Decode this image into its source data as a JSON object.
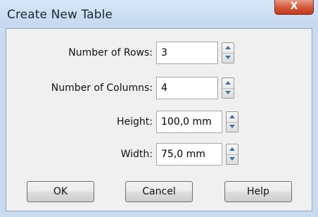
{
  "window": {
    "title": "Create New Table",
    "close_symbol": "X"
  },
  "fields": [
    {
      "label": "Number of Rows:",
      "value": "3"
    },
    {
      "label": "Number of Columns:",
      "value": "4"
    },
    {
      "label": "Height:",
      "value": "100,0 mm"
    },
    {
      "label": "Width:",
      "value": "75,0 mm"
    }
  ],
  "buttons": {
    "ok": "OK",
    "cancel": "Cancel",
    "help": "Help"
  },
  "icons": {
    "close": "close-icon",
    "spin_up": "arrow-up-icon",
    "spin_down": "arrow-down-icon"
  }
}
